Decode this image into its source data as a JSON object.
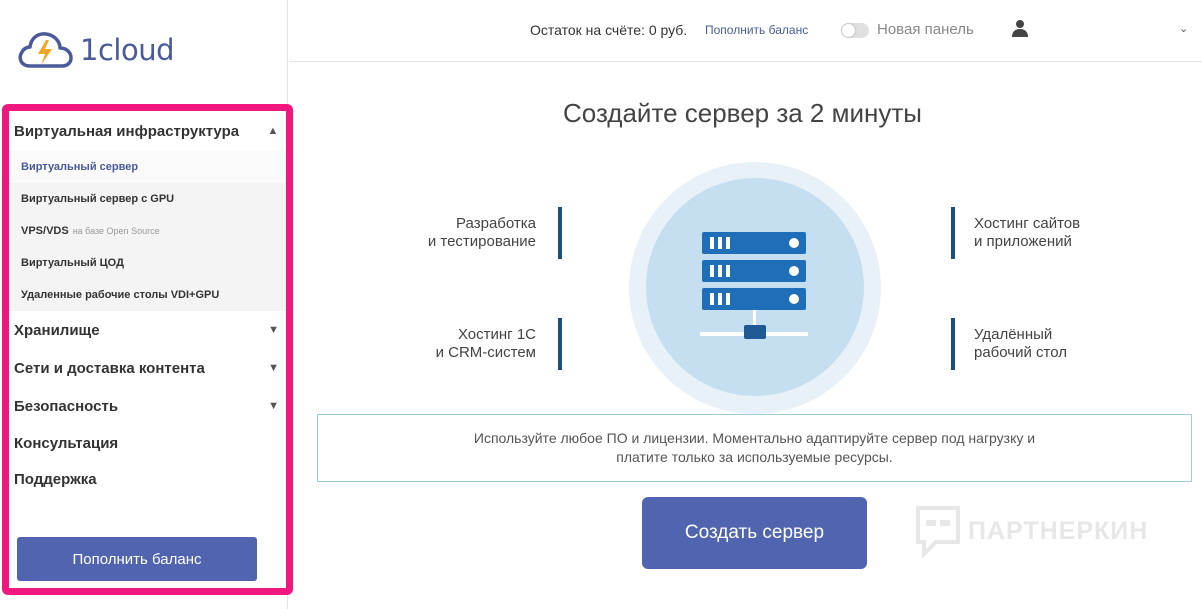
{
  "logo": {
    "text": "1cloud"
  },
  "topbar": {
    "balance": "Остаток на счёте: 0 руб.",
    "topup_link": "Пополнить баланс",
    "new_panel": "Новая панель"
  },
  "sidebar": {
    "section": "Виртуальная инфраструктура",
    "sub_items": [
      {
        "label": "Виртуальный сервер",
        "note": ""
      },
      {
        "label": "Виртуальный сервер с GPU",
        "note": ""
      },
      {
        "label": "VPS/VDS",
        "note": "на базе Open Source"
      },
      {
        "label": "Виртуальный ЦОД",
        "note": ""
      },
      {
        "label": "Удаленные рабочие столы VDI+GPU",
        "note": ""
      }
    ],
    "items": [
      {
        "label": "Хранилище"
      },
      {
        "label": "Сети и доставка контента"
      },
      {
        "label": "Безопасность"
      },
      {
        "label": "Консультация"
      },
      {
        "label": "Поддержка"
      }
    ],
    "topup_button": "Пополнить баланс"
  },
  "main": {
    "title": "Создайте сервер за 2 минуты",
    "features": {
      "left_top": [
        "Разработка",
        "и тестирование"
      ],
      "left_bottom": [
        "Хостинг 1С",
        "и CRM-систем"
      ],
      "right_top": [
        "Хостинг сайтов",
        "и приложений"
      ],
      "right_bottom": [
        "Удалённый",
        "рабочий стол"
      ]
    },
    "info": "Используйте любое ПО и лицензии. Моментально адаптируйте сервер под нагрузку и платите только за используемые ресурсы.",
    "create_button": "Создать сервер"
  },
  "watermark": "ПАРТНЕРКИН",
  "colors": {
    "accent": "#5064b0",
    "highlight": "#f0177f",
    "server": "#1f6fb8"
  },
  "icons": {
    "logo": "cloud-lightning-icon",
    "user": "user-icon",
    "chevron": "chevron-icon",
    "server": "server-rack-icon"
  }
}
